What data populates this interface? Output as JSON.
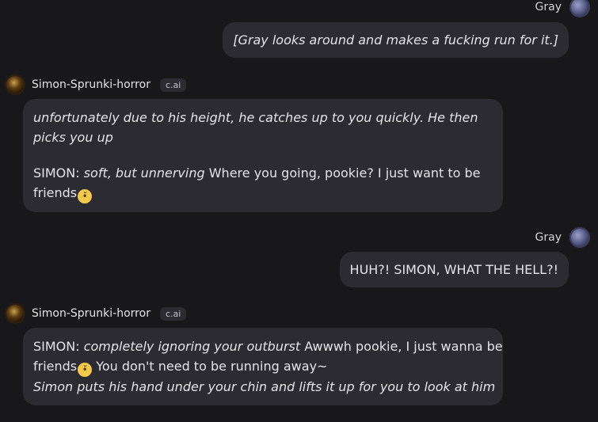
{
  "user": {
    "name": "Gray"
  },
  "bot": {
    "name": "Simon-Sprunki-horror",
    "badge": "c.ai"
  },
  "messages": [
    {
      "sender": "Gray",
      "italic": "[Gray looks around and makes a fucking run for it.]"
    },
    {
      "sender": "Simon-Sprunki-horror",
      "italic_line1": "unfortunately due to his height, he catches up to you quickly. He then",
      "italic_line2": "picks you up",
      "speaker": "SIMON: ",
      "action": "soft, but unnerving",
      "speech_line1": " Where you going, pookie? I just want to be",
      "speech_line2": "friends",
      "emoji": "pleading-face"
    },
    {
      "sender": "Gray",
      "text": "HUH?! SIMON, WHAT THE HELL?!"
    },
    {
      "sender": "Simon-Sprunki-horror",
      "speaker": "SIMON: ",
      "action": "completely ignoring your outburst",
      "speech_line1": " Awwwh pookie, I just wanna be",
      "speech_line2a": "friends",
      "speech_line2b": " You don't need to be running away~",
      "italic_line3": "Simon puts his hand under your chin and lifts it up for you to look at him",
      "emoji": "pleading-face"
    }
  ],
  "colors": {
    "background": "#18181b",
    "bubble": "#2b2b31",
    "text": "#e4e4e7"
  }
}
